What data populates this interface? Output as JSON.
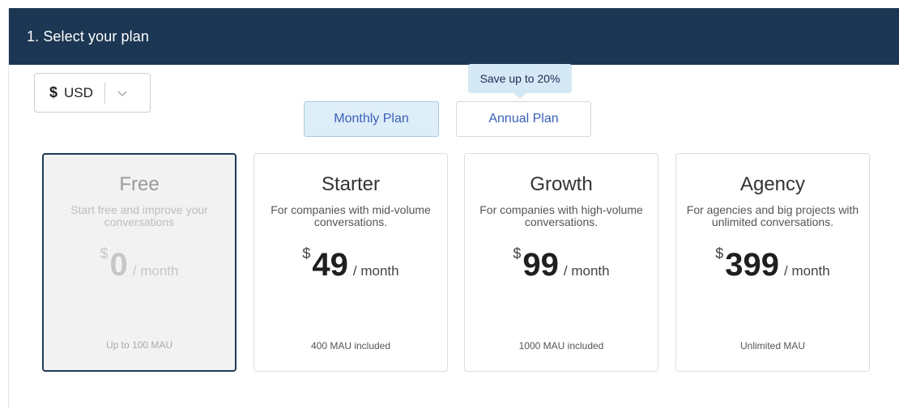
{
  "header": {
    "title": "1. Select your plan"
  },
  "currency": {
    "symbol": "$",
    "code": "USD"
  },
  "billing": {
    "save_badge": "Save up to 20%",
    "monthly_label": "Monthly Plan",
    "annual_label": "Annual Plan",
    "selected": "monthly"
  },
  "plans": [
    {
      "name": "Free",
      "description": "Start free and improve your conversations",
      "currency": "$",
      "price": "0",
      "period": "/ month",
      "footer": "Up to 100 MAU",
      "selected": true
    },
    {
      "name": "Starter",
      "description": "For companies with mid-volume conversations.",
      "currency": "$",
      "price": "49",
      "period": "/ month",
      "footer": "400 MAU included",
      "selected": false
    },
    {
      "name": "Growth",
      "description": "For companies with high-volume conversations.",
      "currency": "$",
      "price": "99",
      "period": "/ month",
      "footer": "1000 MAU included",
      "selected": false
    },
    {
      "name": "Agency",
      "description": "For agencies and big projects with unlimited conversations.",
      "currency": "$",
      "price": "399",
      "period": "/ month",
      "footer": "Unlimited MAU",
      "selected": false
    }
  ],
  "colors": {
    "header_bg": "#1b3753",
    "accent_link": "#3a5fb8",
    "selected_border": "#1f3a56",
    "badge_bg": "#d5e8f6"
  },
  "icons": {
    "currency_dropdown": "chevron-down-icon"
  }
}
